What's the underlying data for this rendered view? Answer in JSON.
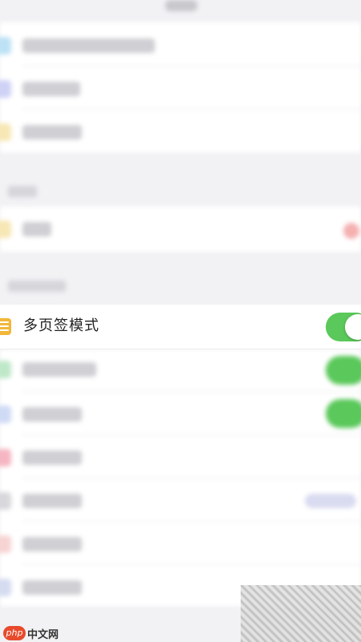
{
  "settings": {
    "multi_tab_mode": {
      "label": "多页签模式",
      "enabled": true,
      "icon": "notes-icon"
    }
  },
  "watermark": {
    "logo": "php",
    "text": "中文网"
  },
  "colors": {
    "toggle_on": "#5ac85a",
    "icon_accent": "#f2b739",
    "background": "#f2f2f5"
  }
}
